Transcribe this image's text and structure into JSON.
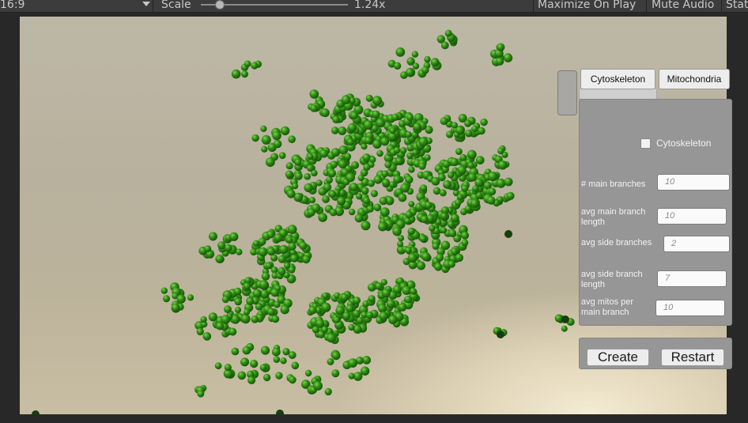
{
  "toolbar": {
    "aspect_label": "16:9",
    "scale_label": "Scale",
    "scale_value": "1.24x",
    "maximize_label": "Maximize On Play",
    "mute_label": "Mute Audio",
    "stats_label": "Stats"
  },
  "colors": {
    "sphere_fill": "#2e8c12",
    "sphere_highlight": "#7ed051",
    "sphere_shadow": "#134a05"
  },
  "panel": {
    "tabs": [
      "Cytoskeleton",
      "Mitochondria"
    ],
    "checkbox_label": "Cytoskeleton",
    "checkbox_checked": false,
    "fields": [
      {
        "label": "# main branches",
        "value": "10"
      },
      {
        "label": "avg main branch length",
        "value": "10"
      },
      {
        "label": "avg side branches",
        "value": "2"
      },
      {
        "label": "avg side branch length",
        "value": "7"
      },
      {
        "label": "avg mitos per main branch",
        "value": "10"
      }
    ],
    "create_label": "Create",
    "restart_label": "Restart"
  }
}
